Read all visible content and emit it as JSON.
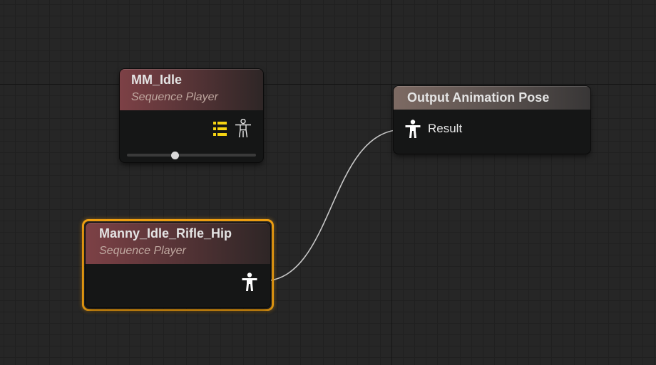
{
  "graph": {
    "nodes": {
      "mm_idle": {
        "title": "MM_Idle",
        "subtitle": "Sequence Player",
        "playback_position": 0.37
      },
      "manny_idle_rifle_hip": {
        "title": "Manny_Idle_Rifle_Hip",
        "subtitle": "Sequence Player",
        "selected": true
      },
      "output_pose": {
        "title": "Output Animation Pose",
        "result_pin_label": "Result"
      }
    },
    "icons": {
      "pose_pin": "pose-pin-icon",
      "asset_list": "asset-list-icon"
    },
    "colors": {
      "background": "#262626",
      "selection": "#f0a012",
      "sequence_header": "#7d4146",
      "output_header": "#7d6a63",
      "asset_icon": "#f5d312",
      "wire": "#c8c8c8"
    }
  }
}
